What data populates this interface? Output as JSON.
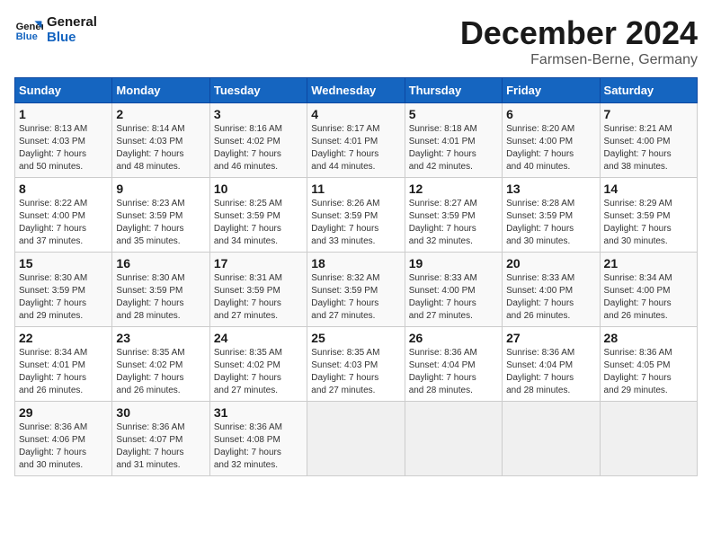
{
  "header": {
    "logo_line1": "General",
    "logo_line2": "Blue",
    "month_title": "December 2024",
    "subtitle": "Farmsen-Berne, Germany"
  },
  "weekdays": [
    "Sunday",
    "Monday",
    "Tuesday",
    "Wednesday",
    "Thursday",
    "Friday",
    "Saturday"
  ],
  "weeks": [
    [
      {
        "day": "1",
        "info": "Sunrise: 8:13 AM\nSunset: 4:03 PM\nDaylight: 7 hours\nand 50 minutes."
      },
      {
        "day": "2",
        "info": "Sunrise: 8:14 AM\nSunset: 4:03 PM\nDaylight: 7 hours\nand 48 minutes."
      },
      {
        "day": "3",
        "info": "Sunrise: 8:16 AM\nSunset: 4:02 PM\nDaylight: 7 hours\nand 46 minutes."
      },
      {
        "day": "4",
        "info": "Sunrise: 8:17 AM\nSunset: 4:01 PM\nDaylight: 7 hours\nand 44 minutes."
      },
      {
        "day": "5",
        "info": "Sunrise: 8:18 AM\nSunset: 4:01 PM\nDaylight: 7 hours\nand 42 minutes."
      },
      {
        "day": "6",
        "info": "Sunrise: 8:20 AM\nSunset: 4:00 PM\nDaylight: 7 hours\nand 40 minutes."
      },
      {
        "day": "7",
        "info": "Sunrise: 8:21 AM\nSunset: 4:00 PM\nDaylight: 7 hours\nand 38 minutes."
      }
    ],
    [
      {
        "day": "8",
        "info": "Sunrise: 8:22 AM\nSunset: 4:00 PM\nDaylight: 7 hours\nand 37 minutes."
      },
      {
        "day": "9",
        "info": "Sunrise: 8:23 AM\nSunset: 3:59 PM\nDaylight: 7 hours\nand 35 minutes."
      },
      {
        "day": "10",
        "info": "Sunrise: 8:25 AM\nSunset: 3:59 PM\nDaylight: 7 hours\nand 34 minutes."
      },
      {
        "day": "11",
        "info": "Sunrise: 8:26 AM\nSunset: 3:59 PM\nDaylight: 7 hours\nand 33 minutes."
      },
      {
        "day": "12",
        "info": "Sunrise: 8:27 AM\nSunset: 3:59 PM\nDaylight: 7 hours\nand 32 minutes."
      },
      {
        "day": "13",
        "info": "Sunrise: 8:28 AM\nSunset: 3:59 PM\nDaylight: 7 hours\nand 30 minutes."
      },
      {
        "day": "14",
        "info": "Sunrise: 8:29 AM\nSunset: 3:59 PM\nDaylight: 7 hours\nand 30 minutes."
      }
    ],
    [
      {
        "day": "15",
        "info": "Sunrise: 8:30 AM\nSunset: 3:59 PM\nDaylight: 7 hours\nand 29 minutes."
      },
      {
        "day": "16",
        "info": "Sunrise: 8:30 AM\nSunset: 3:59 PM\nDaylight: 7 hours\nand 28 minutes."
      },
      {
        "day": "17",
        "info": "Sunrise: 8:31 AM\nSunset: 3:59 PM\nDaylight: 7 hours\nand 27 minutes."
      },
      {
        "day": "18",
        "info": "Sunrise: 8:32 AM\nSunset: 3:59 PM\nDaylight: 7 hours\nand 27 minutes."
      },
      {
        "day": "19",
        "info": "Sunrise: 8:33 AM\nSunset: 4:00 PM\nDaylight: 7 hours\nand 27 minutes."
      },
      {
        "day": "20",
        "info": "Sunrise: 8:33 AM\nSunset: 4:00 PM\nDaylight: 7 hours\nand 26 minutes."
      },
      {
        "day": "21",
        "info": "Sunrise: 8:34 AM\nSunset: 4:00 PM\nDaylight: 7 hours\nand 26 minutes."
      }
    ],
    [
      {
        "day": "22",
        "info": "Sunrise: 8:34 AM\nSunset: 4:01 PM\nDaylight: 7 hours\nand 26 minutes."
      },
      {
        "day": "23",
        "info": "Sunrise: 8:35 AM\nSunset: 4:02 PM\nDaylight: 7 hours\nand 26 minutes."
      },
      {
        "day": "24",
        "info": "Sunrise: 8:35 AM\nSunset: 4:02 PM\nDaylight: 7 hours\nand 27 minutes."
      },
      {
        "day": "25",
        "info": "Sunrise: 8:35 AM\nSunset: 4:03 PM\nDaylight: 7 hours\nand 27 minutes."
      },
      {
        "day": "26",
        "info": "Sunrise: 8:36 AM\nSunset: 4:04 PM\nDaylight: 7 hours\nand 28 minutes."
      },
      {
        "day": "27",
        "info": "Sunrise: 8:36 AM\nSunset: 4:04 PM\nDaylight: 7 hours\nand 28 minutes."
      },
      {
        "day": "28",
        "info": "Sunrise: 8:36 AM\nSunset: 4:05 PM\nDaylight: 7 hours\nand 29 minutes."
      }
    ],
    [
      {
        "day": "29",
        "info": "Sunrise: 8:36 AM\nSunset: 4:06 PM\nDaylight: 7 hours\nand 30 minutes."
      },
      {
        "day": "30",
        "info": "Sunrise: 8:36 AM\nSunset: 4:07 PM\nDaylight: 7 hours\nand 31 minutes."
      },
      {
        "day": "31",
        "info": "Sunrise: 8:36 AM\nSunset: 4:08 PM\nDaylight: 7 hours\nand 32 minutes."
      },
      {
        "day": "",
        "info": ""
      },
      {
        "day": "",
        "info": ""
      },
      {
        "day": "",
        "info": ""
      },
      {
        "day": "",
        "info": ""
      }
    ]
  ]
}
